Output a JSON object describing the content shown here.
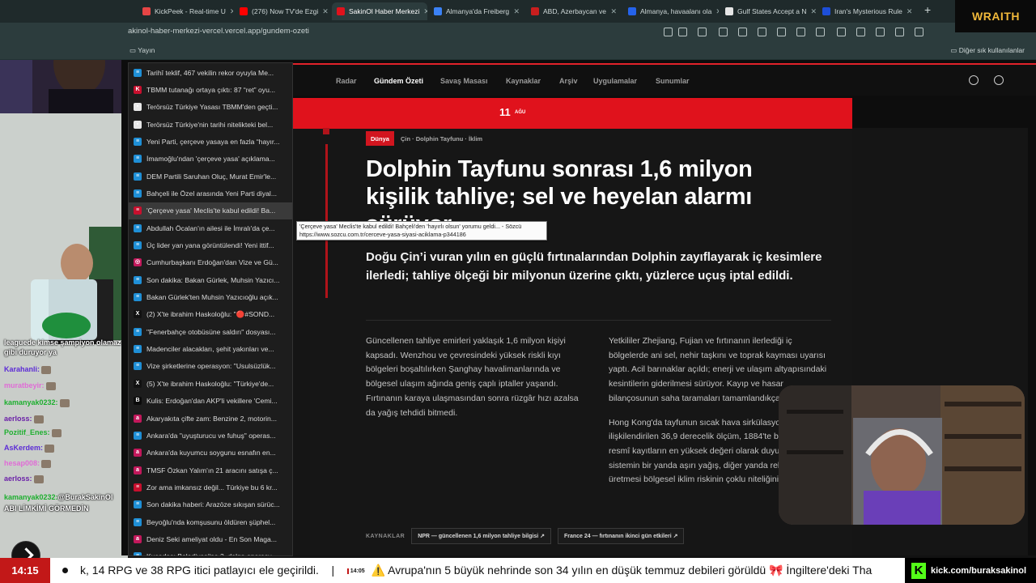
{
  "browser": {
    "tabs": [
      {
        "label": "KickPeek - Real-time U",
        "icon_color": "#e64545",
        "active": false
      },
      {
        "label": "(276) Now TV'de Ezgi",
        "icon_color": "#ff0000",
        "active": false
      },
      {
        "label": "SakinOl Haber Merkezi",
        "icon_color": "#e0121c",
        "active": true
      },
      {
        "label": "Almanya'da Freiberg",
        "icon_color": "#3b82f6",
        "active": false
      },
      {
        "label": "ABD, Azerbaycan ve",
        "icon_color": "#c81e1e",
        "active": false
      },
      {
        "label": "Almanya, havaalanı ola",
        "icon_color": "#2563eb",
        "active": false
      },
      {
        "label": "Gulf States Accept a N",
        "icon_color": "#e5e5e5",
        "active": false
      },
      {
        "label": "Iran's Mysterious Rule",
        "icon_color": "#1d4ed8",
        "active": false
      }
    ],
    "url": "akinol-haber-merkezi-vercel.vercel.app/gundem-ozeti",
    "bookmark_folder": "Yayın",
    "other_bookmarks": "Diğer sık kullanılanlar"
  },
  "site": {
    "nav": [
      "Radar",
      "Gündem Özeti",
      "Savaş Masası",
      "Kaynaklar",
      "Arşiv",
      "Uygulamalar",
      "Sunumlar"
    ],
    "active_nav": "Gündem Özeti",
    "date_day": "11",
    "date_month": "AĞU"
  },
  "article": {
    "badge": "Dünya",
    "tags": "Çin · Dolphin Tayfunu · İklim",
    "headline": "Dolphin Tayfunu sonrası 1,6 milyon kişilik tahliye; sel ve heyelan alarmı sürüyor",
    "lead": "Doğu Çin’i vuran yılın en güçlü fırtınalarından Dolphin zayıflayarak iç kesimlere ilerledi; tahliye ölçeği bir milyonun üzerine çıktı, yüzlerce uçuş iptal edildi.",
    "col1": "Güncellenen tahliye emirleri yaklaşık 1,6 milyon kişiyi kapsadı. Wenzhou ve çevresindeki yüksek riskli kıyı bölgeleri boşaltılırken Şanghay havalimanlarında ve bölgesel ulaşım ağında geniş çaplı iptaller yaşandı. Fırtınanın karaya ulaşmasından sonra rüzgâr hızı azalsa da yağış tehdidi bitmedi.",
    "col2_p1": "Yetkililer Zhejiang, Fujian ve fırtınanın ilerlediği iç bölgelerde ani sel, nehir taşkını ve toprak kayması uyarısı yaptı. Acil barınaklar açıldı; enerji ve ulaşım altyapısındaki kesintilerin giderilmesi sürüyor. Kayıp ve hasar bilançosunun saha taramaları tamamlandıkça beklenior.",
    "col2_p2": "Hong Kong'da tayfunun sıcak hava sirkülasyonuyla ilişkilendirilen 36,9 derecelik ölçüm, 1884'te başlayan resmî kayıtların en yüksek değeri olarak duyuruldu. Fırtına sistemin bir yanda aşırı yağış, diğer yanda rekor sıcaklık üretmesi bölgesel iklim riskinin çoklu niteliğini",
    "sources_label": "KAYNAKLAR",
    "sources": [
      "NPR — güncellenen 1,6 milyon tahliye bilgisi ↗",
      "France 24 — fırtınanın ikinci gün etkileri ↗"
    ]
  },
  "tooltip": {
    "line1": "'Çerçeve yasa' Meclis'te kabul edildi! Bahçeli'den 'hayırlı olsun' yorumu geldi... - Sözcü",
    "line2": "https://www.sozcu.com.tr/cerceve-yasa-siyasi-aciklama-p344186"
  },
  "history": [
    {
      "label": "Tarihî teklif, 467 vekilin rekor oyuyla Me...",
      "icon": "#1f8fd6",
      "glyph": "≡"
    },
    {
      "label": "TBMM tutanağı ortaya çıktı: 87 “ret” oyu...",
      "icon": "#c8102e",
      "glyph": "K"
    },
    {
      "label": "Terörsüz Türkiye Yasası TBMM'den geçti...",
      "icon": "#e8e8e8",
      "glyph": "▪"
    },
    {
      "label": "Terörsüz Türkiye'nin tarihi nitelikteki bel...",
      "icon": "#e8e8e8",
      "glyph": "▪"
    },
    {
      "label": "Yeni Parti, çerçeve yasaya en fazla “hayır...",
      "icon": "#1f8fd6",
      "glyph": "≡"
    },
    {
      "label": "İmamoğlu'ndan 'çerçeve yasa' açıklama...",
      "icon": "#1f8fd6",
      "glyph": "≡"
    },
    {
      "label": "DEM Partili Saruhan Oluç, Murat Emir'le...",
      "icon": "#1f8fd6",
      "glyph": "≡"
    },
    {
      "label": "Bahçeli ile Özel arasında Yeni Parti diyal...",
      "icon": "#1f8fd6",
      "glyph": "≡"
    },
    {
      "label": "'Çerçeve yasa' Meclis'te kabul edildi! Ba...",
      "icon": "#c8102e",
      "glyph": "≡",
      "hover": true
    },
    {
      "label": "Abdullah Öcalan'ın ailesi ile İmralı'da çe...",
      "icon": "#1f8fd6",
      "glyph": "≡"
    },
    {
      "label": "Üç lider yan yana görüntülendi! Yeni ittif...",
      "icon": "#1f8fd6",
      "glyph": "≡"
    },
    {
      "label": "Cumhurbaşkanı Erdoğan'dan Vize ve Gü...",
      "icon": "#c2185b",
      "glyph": "◎"
    },
    {
      "label": "Son dakika: Bakan Gürlek, Muhsin Yazıcı...",
      "icon": "#1f8fd6",
      "glyph": "≡"
    },
    {
      "label": "Bakan Gürlek'ten Muhsin Yazıcıoğlu açık...",
      "icon": "#1f8fd6",
      "glyph": "≡"
    },
    {
      "label": "(2) X'te ibrahim Haskoloğlu: \"🔴#SOND...",
      "icon": "#111111",
      "glyph": "X"
    },
    {
      "label": "\"Fenerbahçe otobüsüne saldırı\" dosyası...",
      "icon": "#1f8fd6",
      "glyph": "≡"
    },
    {
      "label": "Madenciler alacakları, şehit yakınları ve...",
      "icon": "#1f8fd6",
      "glyph": "≡"
    },
    {
      "label": "Vize şirketlerine operasyon: \"Usulsüzlük...",
      "icon": "#1f8fd6",
      "glyph": "≡"
    },
    {
      "label": "(5) X'te ibrahim Haskoloğlu: \"Türkiye'de...",
      "icon": "#111111",
      "glyph": "X"
    },
    {
      "label": "Kulis: Erdoğan'dan AKP'li vekillere 'Cemi...",
      "icon": "#0b0b0b",
      "glyph": "B"
    },
    {
      "label": "Akaryakıta çifte zam: Benzine 2, motorin...",
      "icon": "#c2185b",
      "glyph": "a"
    },
    {
      "label": "Ankara'da \"uyuşturucu ve fuhuş\" operas...",
      "icon": "#1f8fd6",
      "glyph": "≡"
    },
    {
      "label": "Ankara'da kuyumcu soygunu esnafın en...",
      "icon": "#c2185b",
      "glyph": "a"
    },
    {
      "label": "TMSF Özkan Yalım'ın 21 aracını satışa ç...",
      "icon": "#c2185b",
      "glyph": "a"
    },
    {
      "label": "Zor ama imkansız değil... Türkiye bu 6 kr...",
      "icon": "#c8102e",
      "glyph": "≡"
    },
    {
      "label": "Son dakika haberi: Arazöze sıkışan sürüc...",
      "icon": "#1f8fd6",
      "glyph": "≡"
    },
    {
      "label": "Beyoğlu'nda komşusunu öldüren şüphel...",
      "icon": "#1f8fd6",
      "glyph": "≡"
    },
    {
      "label": "Deniz Seki ameliyat oldu - En Son Maga...",
      "icon": "#c2185b",
      "glyph": "a"
    },
    {
      "label": "Kuşadası Belediyesi'ne 3. dalga operasy...",
      "icon": "#1f8fd6",
      "glyph": "≡"
    }
  ],
  "chat": [
    {
      "user": "",
      "msg": "leaguede kimse şampiyon olamaz",
      "color": "#ffffff",
      "emote": false
    },
    {
      "user": "",
      "msg": "gibi duruyor ya",
      "color": "#ffffff",
      "emote": false
    },
    {
      "user": "Karahanli:",
      "msg": "",
      "color": "#5c2bd6",
      "emote": true
    },
    {
      "user": "muratbeyir:",
      "msg": "",
      "color": "#e06cd6",
      "emote": true
    },
    {
      "user": "kamanyak0232:",
      "msg": "",
      "color": "#1eaf2f",
      "emote": true
    },
    {
      "user": "aerloss:",
      "msg": "",
      "color": "#6b21a8",
      "emote": true
    },
    {
      "user": "Pozitif_Enes:",
      "msg": "",
      "color": "#1eaf2f",
      "emote": true
    },
    {
      "user": "AsKerdem:",
      "msg": "",
      "color": "#5c2bd6",
      "emote": true
    },
    {
      "user": "hesap008:",
      "msg": "",
      "color": "#e06cd6",
      "emote": true
    },
    {
      "user": "aerloss:",
      "msg": "",
      "color": "#6b21a8",
      "emote": true
    },
    {
      "user": "kamanyak0232:",
      "msg": "@BurakSakinOl",
      "color": "#1eaf2f",
      "emote": false
    },
    {
      "user": "",
      "msg": "ABI LİMKİMİ GÖRMEDİN",
      "color": "#ffffff",
      "emote": false
    }
  ],
  "overlay": {
    "brand": "WRAITH"
  },
  "ticker": {
    "time": "14:15",
    "text_a": "k, 14 RPG ve 38 RPG itici patlayıcı ele geçirildi.",
    "sep": "|",
    "stamp": "14:05",
    "text_b": "⚠️ Avrupa'nın 5 büyük nehrinde son 34 yılın en düşük temmuz debileri görüldü 🎀 İngiltere'deki Tha",
    "kick_url": "kick.com/buraksakinol"
  }
}
